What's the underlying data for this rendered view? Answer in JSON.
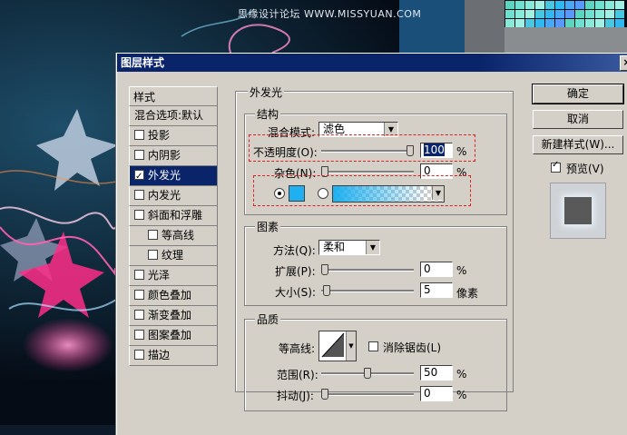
{
  "watermark": "思缘设计论坛  WWW.MISSYUAN.COM",
  "colors": {
    "title_bar": "#0a246a",
    "glow_color": "#1eb0f0",
    "selection": "#0a246a"
  },
  "dialog": {
    "title": "图层样式",
    "close_glyph": "×",
    "styles_header": "样式",
    "items": [
      {
        "label": "混合选项:默认",
        "checkbox": false,
        "checked": false,
        "sub": false,
        "selected": false
      },
      {
        "label": "投影",
        "checkbox": true,
        "checked": false,
        "sub": false,
        "selected": false
      },
      {
        "label": "内阴影",
        "checkbox": true,
        "checked": false,
        "sub": false,
        "selected": false
      },
      {
        "label": "外发光",
        "checkbox": true,
        "checked": true,
        "sub": false,
        "selected": true
      },
      {
        "label": "内发光",
        "checkbox": true,
        "checked": false,
        "sub": false,
        "selected": false
      },
      {
        "label": "斜面和浮雕",
        "checkbox": true,
        "checked": false,
        "sub": false,
        "selected": false
      },
      {
        "label": "等高线",
        "checkbox": true,
        "checked": false,
        "sub": true,
        "selected": false
      },
      {
        "label": "纹理",
        "checkbox": true,
        "checked": false,
        "sub": true,
        "selected": false
      },
      {
        "label": "光泽",
        "checkbox": true,
        "checked": false,
        "sub": false,
        "selected": false
      },
      {
        "label": "颜色叠加",
        "checkbox": true,
        "checked": false,
        "sub": false,
        "selected": false
      },
      {
        "label": "渐变叠加",
        "checkbox": true,
        "checked": false,
        "sub": false,
        "selected": false
      },
      {
        "label": "图案叠加",
        "checkbox": true,
        "checked": false,
        "sub": false,
        "selected": false
      },
      {
        "label": "描边",
        "checkbox": true,
        "checked": false,
        "sub": false,
        "selected": false
      }
    ],
    "section_title": "外发光",
    "structure": {
      "title": "结构",
      "blend_mode_label": "混合模式:",
      "blend_mode_value": "滤色",
      "opacity_label": "不透明度(O):",
      "opacity_value": "100",
      "opacity_level": 100,
      "noise_label": "杂色(N):",
      "noise_value": "0",
      "noise_level": 0,
      "percent": "%"
    },
    "elements": {
      "title": "图素",
      "method_label": "方法(Q):",
      "method_value": "柔和",
      "spread_label": "扩展(P):",
      "spread_value": "0",
      "spread_level": 0,
      "size_label": "大小(S):",
      "size_value": "5",
      "size_level": 2,
      "percent": "%",
      "pixels": "像素"
    },
    "quality": {
      "title": "品质",
      "contour_label": "等高线:",
      "anti_alias_label": "消除锯齿(L)",
      "range_label": "范围(R):",
      "range_value": "50",
      "range_level": 50,
      "jitter_label": "抖动(J):",
      "jitter_value": "0",
      "jitter_level": 0,
      "percent": "%"
    },
    "buttons": {
      "ok": "确定",
      "cancel": "取消",
      "new_style": "新建样式(W)...",
      "preview_label": "预览(V)",
      "preview_checked": true
    }
  }
}
